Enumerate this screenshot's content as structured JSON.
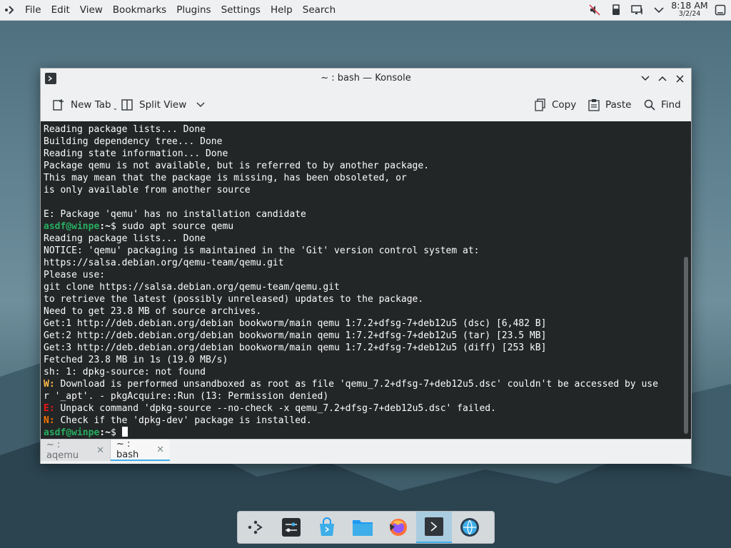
{
  "panel": {
    "menu": [
      "File",
      "Edit",
      "View",
      "Bookmarks",
      "Plugins",
      "Settings",
      "Help",
      "Search"
    ],
    "clock_time": "8:18 AM",
    "clock_date": "3/2/24"
  },
  "window": {
    "title": "~ : bash — Konsole"
  },
  "toolbar": {
    "new_tab": "New Tab",
    "split_view": "Split View",
    "copy": "Copy",
    "paste": "Paste",
    "find": "Find"
  },
  "terminal": {
    "lines": [
      {
        "text": "Reading package lists... Done"
      },
      {
        "text": "Building dependency tree... Done"
      },
      {
        "text": "Reading state information... Done"
      },
      {
        "text": "Package qemu is not available, but is referred to by another package."
      },
      {
        "text": "This may mean that the package is missing, has been obsoleted, or"
      },
      {
        "text": "is only available from another source"
      },
      {
        "text": ""
      },
      {
        "text": "E: Package 'qemu' has no installation candidate"
      },
      {
        "prompt": "asdf@winpe",
        "path": ":~",
        "text": "$ sudo apt source qemu"
      },
      {
        "text": "Reading package lists... Done"
      },
      {
        "text": "NOTICE: 'qemu' packaging is maintained in the 'Git' version control system at:"
      },
      {
        "text": "https://salsa.debian.org/qemu-team/qemu.git"
      },
      {
        "text": "Please use:"
      },
      {
        "text": "git clone https://salsa.debian.org/qemu-team/qemu.git"
      },
      {
        "text": "to retrieve the latest (possibly unreleased) updates to the package."
      },
      {
        "text": "Need to get 23.8 MB of source archives."
      },
      {
        "text": "Get:1 http://deb.debian.org/debian bookworm/main qemu 1:7.2+dfsg-7+deb12u5 (dsc) [6,482 B]"
      },
      {
        "text": "Get:2 http://deb.debian.org/debian bookworm/main qemu 1:7.2+dfsg-7+deb12u5 (tar) [23.5 MB]"
      },
      {
        "text": "Get:3 http://deb.debian.org/debian bookworm/main qemu 1:7.2+dfsg-7+deb12u5 (diff) [253 kB]"
      },
      {
        "text": "Fetched 23.8 MB in 1s (19.0 MB/s)"
      },
      {
        "text": "sh: 1: dpkg-source: not found"
      },
      {
        "tag": "W:",
        "tag_class": "warn",
        "text": " Download is performed unsandboxed as root as file 'qemu_7.2+dfsg-7+deb12u5.dsc' couldn't be accessed by use"
      },
      {
        "text": "r '_apt'. - pkgAcquire::Run (13: Permission denied)"
      },
      {
        "tag": "E:",
        "tag_class": "err",
        "text": " Unpack command 'dpkg-source --no-check -x qemu_7.2+dfsg-7+deb12u5.dsc' failed."
      },
      {
        "tag": "N:",
        "tag_class": "note",
        "text": " Check if the 'dpkg-dev' package is installed."
      },
      {
        "prompt": "asdf@winpe",
        "path": ":~",
        "text": "$ ",
        "cursor": true
      }
    ]
  },
  "tabs": [
    {
      "label": "~ : aqemu",
      "active": false
    },
    {
      "label": "~ : bash",
      "active": true
    }
  ]
}
